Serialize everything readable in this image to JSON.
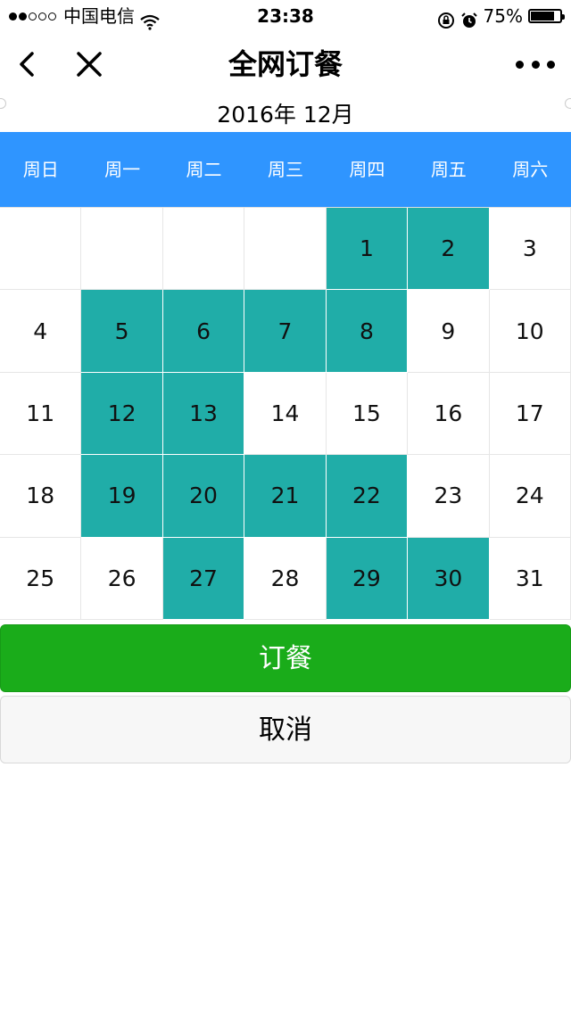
{
  "status_bar": {
    "signal_dots_filled": 2,
    "signal_dots_total": 5,
    "carrier": "中国电信",
    "time": "23:38",
    "battery_percent": "75%",
    "icons": [
      "wifi-icon",
      "orientation-lock-icon",
      "alarm-icon",
      "battery-icon"
    ]
  },
  "nav": {
    "title": "全网订餐",
    "icons": [
      "back-icon",
      "close-icon",
      "more-icon"
    ]
  },
  "calendar": {
    "month_label": "2016年 12月",
    "weekdays": [
      "周日",
      "周一",
      "周二",
      "周三",
      "周四",
      "周五",
      "周六"
    ],
    "weeks": [
      [
        {
          "day": "",
          "selected": false
        },
        {
          "day": "",
          "selected": false
        },
        {
          "day": "",
          "selected": false
        },
        {
          "day": "",
          "selected": false
        },
        {
          "day": "1",
          "selected": true
        },
        {
          "day": "2",
          "selected": true
        },
        {
          "day": "3",
          "selected": false
        }
      ],
      [
        {
          "day": "4",
          "selected": false
        },
        {
          "day": "5",
          "selected": true
        },
        {
          "day": "6",
          "selected": true
        },
        {
          "day": "7",
          "selected": true
        },
        {
          "day": "8",
          "selected": true
        },
        {
          "day": "9",
          "selected": false
        },
        {
          "day": "10",
          "selected": false
        }
      ],
      [
        {
          "day": "11",
          "selected": false
        },
        {
          "day": "12",
          "selected": true
        },
        {
          "day": "13",
          "selected": true
        },
        {
          "day": "14",
          "selected": false
        },
        {
          "day": "15",
          "selected": false
        },
        {
          "day": "16",
          "selected": false
        },
        {
          "day": "17",
          "selected": false
        }
      ],
      [
        {
          "day": "18",
          "selected": false
        },
        {
          "day": "19",
          "selected": true
        },
        {
          "day": "20",
          "selected": true
        },
        {
          "day": "21",
          "selected": true
        },
        {
          "day": "22",
          "selected": true
        },
        {
          "day": "23",
          "selected": false
        },
        {
          "day": "24",
          "selected": false
        }
      ],
      [
        {
          "day": "25",
          "selected": false
        },
        {
          "day": "26",
          "selected": false
        },
        {
          "day": "27",
          "selected": true
        },
        {
          "day": "28",
          "selected": false
        },
        {
          "day": "29",
          "selected": true
        },
        {
          "day": "30",
          "selected": true
        },
        {
          "day": "31",
          "selected": false
        }
      ]
    ],
    "colors": {
      "header_bg": "#2f95ff",
      "selected_bg": "#20ada8"
    }
  },
  "actions": {
    "order_label": "订餐",
    "cancel_label": "取消",
    "order_color": "#1aac1a"
  }
}
